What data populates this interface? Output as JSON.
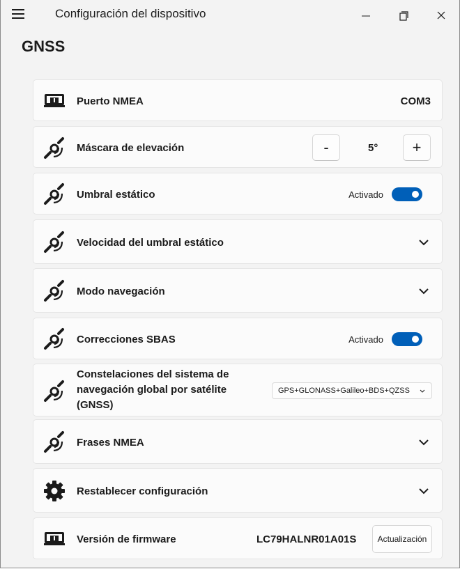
{
  "window": {
    "title": "Configuración del dispositivo",
    "icons": {
      "menu": "hamburger-icon",
      "minimize": "minimize-icon",
      "maximize": "maximize-icon",
      "close": "close-icon"
    }
  },
  "page": {
    "title": "GNSS"
  },
  "settings": {
    "nmea_port": {
      "label": "Puerto NMEA",
      "value": "COM3",
      "icon": "chip-icon"
    },
    "elevation_mask": {
      "label": "Máscara de elevación",
      "value": "5°",
      "decrement": "-",
      "increment": "+",
      "icon": "satellite-icon"
    },
    "static_threshold": {
      "label": "Umbral estático",
      "toggle_label": "Activado",
      "enabled": true,
      "icon": "satellite-icon"
    },
    "static_threshold_speed": {
      "label": "Velocidad del umbral estático",
      "icon": "satellite-icon"
    },
    "navigation_mode": {
      "label": "Modo navegación",
      "icon": "satellite-icon"
    },
    "sbas": {
      "label": "Correcciones SBAS",
      "toggle_label": "Activado",
      "enabled": true,
      "icon": "satellite-icon"
    },
    "constellations": {
      "label_line1": "Constelaciones del sistema de",
      "label_line2": "navegación global por satélite",
      "label_line3": "(GNSS)",
      "selected": "GPS+GLONASS+Galileo+BDS+QZSS",
      "icon": "satellite-icon"
    },
    "nmea_sentences": {
      "label": "Frases NMEA",
      "icon": "satellite-icon"
    },
    "reset": {
      "label": "Restablecer configuración",
      "icon": "gear-icon"
    },
    "firmware": {
      "label": "Versión de firmware",
      "value": "LC79HALNR01A01S",
      "button": "Actualización",
      "icon": "chip-icon"
    }
  },
  "colors": {
    "accent": "#005fb8",
    "card": "#fbfbfb",
    "background": "#f3f3f3"
  }
}
